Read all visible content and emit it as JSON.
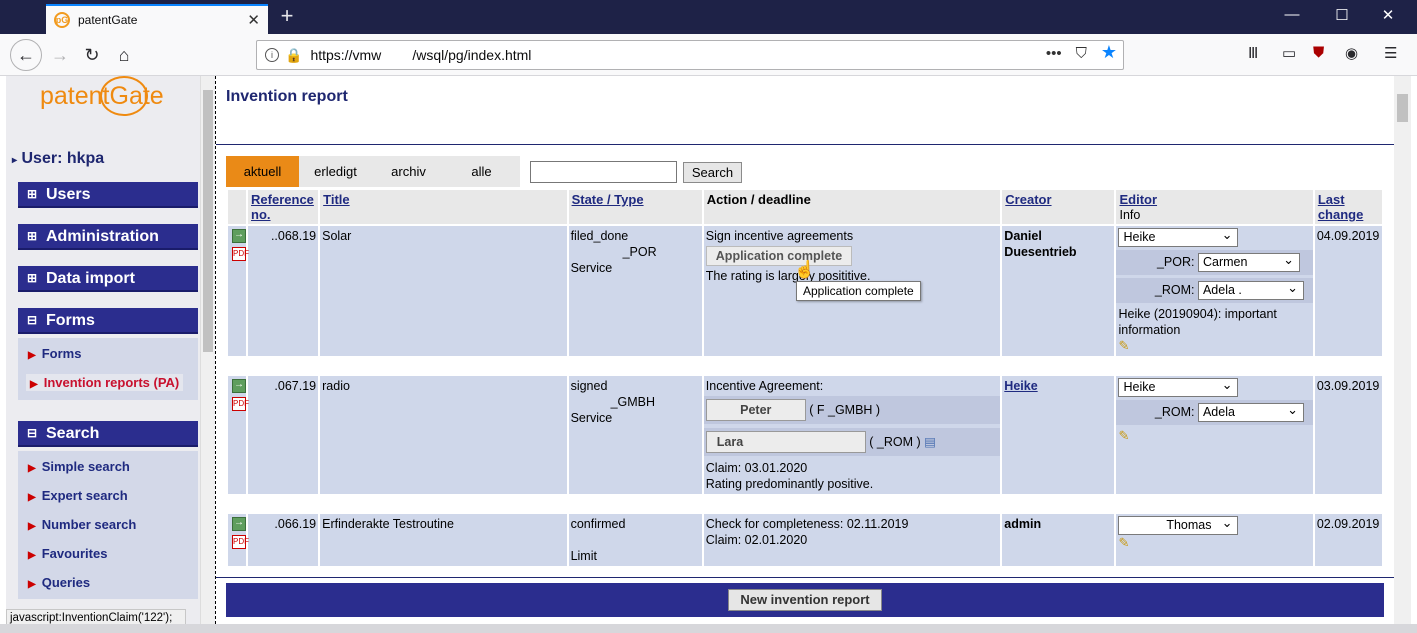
{
  "browser": {
    "tab_title": "patentGate",
    "tab_icon": "patentgate-logo-icon",
    "url_parts": [
      "https://vmw",
      "/wsql/pg/index.html"
    ],
    "status_text": "javascript:InventionClaim('122');"
  },
  "sidebar": {
    "logo": "patentGate",
    "user": "User: hkpa",
    "sections": [
      {
        "label": "Users",
        "state": "+"
      },
      {
        "label": "Administration",
        "state": "+"
      },
      {
        "label": "Data import",
        "state": "+"
      },
      {
        "label": "Forms",
        "state": "-",
        "items": [
          "Forms",
          "Invention reports (PA)"
        ]
      },
      {
        "label": "Search",
        "state": "-",
        "items": [
          "Simple search",
          "Expert search",
          "Number search",
          "Favourites",
          "Queries"
        ]
      }
    ],
    "active_item": "Invention reports (PA)"
  },
  "page": {
    "title": "Invention report",
    "filter_tabs": [
      "aktuell",
      "erledigt",
      "archiv",
      "alle"
    ],
    "active_filter": "aktuell",
    "search_value": "",
    "search_label": "Search",
    "columns": [
      "Reference no.",
      "Title",
      "State / Type",
      "Action / deadline",
      "Creator",
      "Editor",
      "Info",
      "Last change"
    ],
    "rows": [
      {
        "ref": "..068.19",
        "title": "Solar",
        "state": "filed_done",
        "state2": "_POR",
        "type": "Service",
        "action1": "Sign incentive agreements",
        "action_button": "Application complete",
        "action2": "The rating is largely posititive.",
        "creator": "Daniel Duesentrieb",
        "editor": "Heike",
        "sub_editors": [
          {
            "label": "_POR:",
            "value": "Carmen"
          },
          {
            "label": "_ROM:",
            "value": "Adela ."
          }
        ],
        "info": "Heike (20190904): important information",
        "last_change": "04.09.2019"
      },
      {
        "ref": ".067.19",
        "title": "radio",
        "state": "signed",
        "state2": "_GMBH",
        "type": "Service",
        "action1": "Incentive Agreement:",
        "inventors": [
          {
            "name": "Peter",
            "org": "( F        _GMBH )"
          },
          {
            "name": "Lara",
            "org": "(          _ROM )"
          }
        ],
        "claim": "Claim: 03.01.2020",
        "rating": "Rating predominantly positive.",
        "creator": "Heike",
        "editor": "Heike",
        "sub_editors": [
          {
            "label": "_ROM:",
            "value": "Adela"
          }
        ],
        "last_change": "03.09.2019"
      },
      {
        "ref": ".066.19",
        "title": "Erfinderakte Testroutine",
        "state": "confirmed",
        "type": "Limit",
        "action1": "Check for completeness: 02.11.2019",
        "claim": "Claim: 02.01.2020",
        "creator": "admin",
        "editor": "Thomas",
        "last_change": "02.09.2019"
      }
    ],
    "tooltip": "Application complete",
    "new_button": "New invention report"
  }
}
